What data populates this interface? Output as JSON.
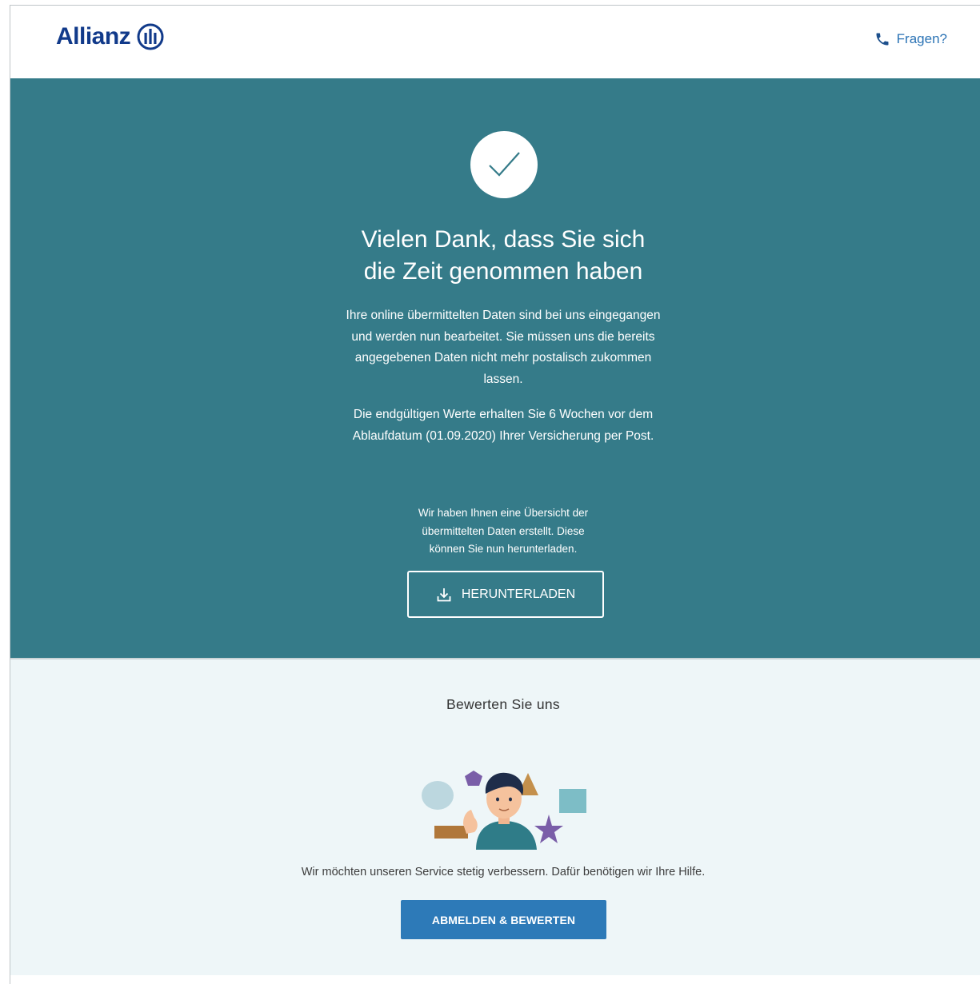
{
  "header": {
    "logo_text": "Allianz",
    "help_label": "Fragen?",
    "help_icon": "phone-icon"
  },
  "hero": {
    "icon": "checkmark-icon",
    "title_line1": "Vielen Dank, dass Sie sich",
    "title_line2": "die Zeit genommen haben",
    "paragraph1": "Ihre online übermittelten Daten sind bei uns eingegangen und werden nun bearbeitet. Sie müssen uns die bereits angegebenen Daten nicht mehr postalisch zukommen lassen.",
    "paragraph2": "Die endgültigen Werte erhalten Sie 6 Wochen vor dem Ablaufdatum (01.09.2020) Ihrer Versicherung per Post.",
    "paragraph3": "Wir haben Ihnen eine Übersicht der übermittelten Daten erstellt. Diese können Sie nun herunterladen.",
    "download_label": "HERUNTERLADEN",
    "download_icon": "download-icon"
  },
  "rating": {
    "title": "Bewerten Sie uns",
    "illustration": "person-with-shapes-illustration",
    "text": "Wir möchten unseren Service stetig verbessern. Dafür benötigen wir Ihre Hilfe.",
    "button_label": "ABMELDEN & BEWERTEN"
  },
  "colors": {
    "brand_blue": "#113a8a",
    "hero_teal": "#357b89",
    "link_blue": "#2b73b5",
    "button_blue": "#2d7ab8",
    "rating_bg": "#eef6f8"
  }
}
